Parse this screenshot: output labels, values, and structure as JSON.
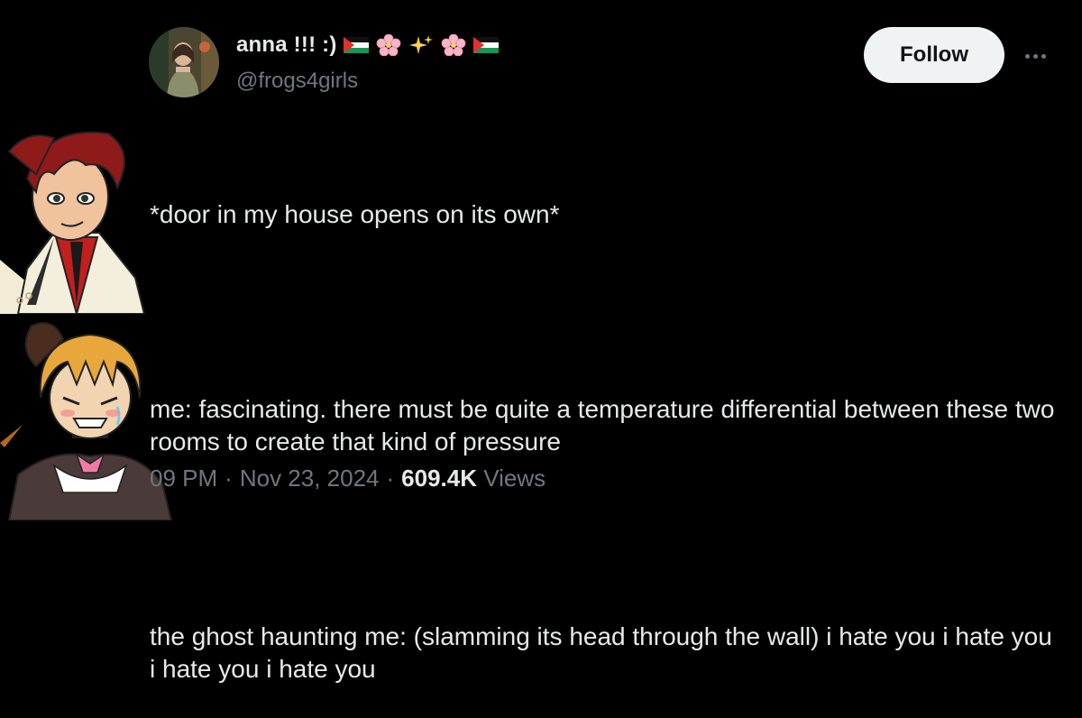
{
  "author": {
    "name": "anna !!! :)",
    "handle": "@frogs4girls",
    "name_emoji": [
      "palestine-flag",
      "cherry-blossom",
      "sparkles",
      "cherry-blossom",
      "palestine-flag"
    ]
  },
  "follow_label": "Follow",
  "tweet": {
    "para1": "*door in my house opens on its own*",
    "para2": "me: fascinating. there must be quite a temperature differential between these two rooms to create that kind of pressure",
    "para3": "the ghost haunting me: (slamming its head through the wall) i hate you i hate you i hate you i hate you"
  },
  "meta": {
    "time": "09 PM",
    "sep1": "·",
    "date": "Nov 23, 2024",
    "sep2": "·",
    "views_count": "609.4K",
    "views_label": "Views"
  },
  "colors": {
    "background": "#000000",
    "text": "#e7e9ea",
    "muted": "#71767b",
    "follow_bg": "#eff3f4"
  }
}
